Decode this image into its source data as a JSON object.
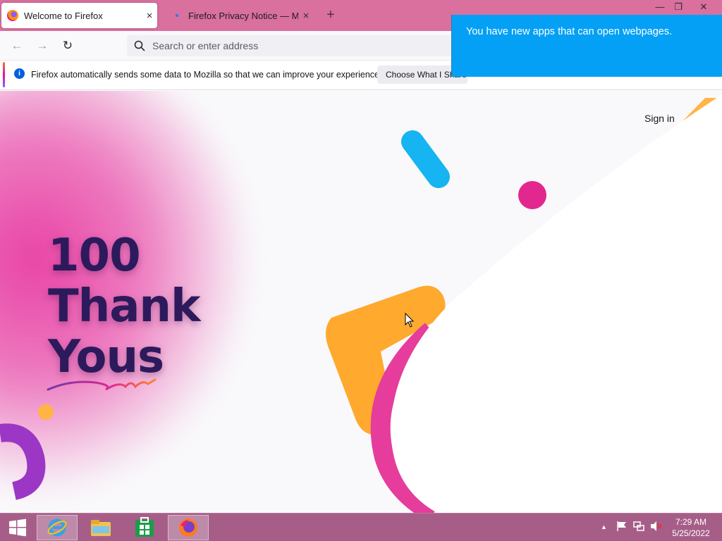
{
  "tabs": [
    {
      "title": "Welcome to Firefox",
      "close": "×",
      "favicon": "firefox-icon"
    },
    {
      "title": "Firefox Privacy Notice — Mozilla",
      "close": "×",
      "favicon": "mozilla-dot-icon"
    }
  ],
  "new_tab": "+",
  "window_controls": {
    "minimize": "—",
    "restore": "❐",
    "close": "✕"
  },
  "nav": {
    "back": "←",
    "forward": "→",
    "reload": "↻"
  },
  "urlbar": {
    "placeholder": "Search or enter address",
    "value": ""
  },
  "infobar": {
    "message": "Firefox automatically sends some data to Mozilla so that we can improve your experience.",
    "button": "Choose What I Share",
    "icon": "i"
  },
  "toast": {
    "message": "You have new apps that can open webpages."
  },
  "page": {
    "headline": [
      "100",
      "Thank",
      "Yous"
    ],
    "sign_in": "Sign in"
  },
  "taskbar": {
    "apps": [
      "start-icon",
      "internet-explorer-icon",
      "file-explorer-icon",
      "store-icon",
      "firefox-icon"
    ],
    "tray_arrow": "▲",
    "time": "7:29 AM",
    "date": "5/25/2022"
  },
  "colors": {
    "tabbar": "#d9709e",
    "toast": "#03a0f5",
    "headline": "#2d1a5c",
    "taskbar": "#a65e88"
  }
}
